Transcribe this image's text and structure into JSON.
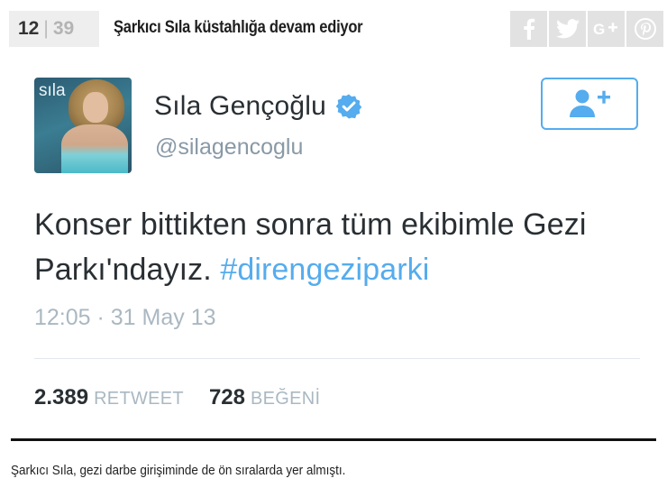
{
  "header": {
    "current_index": "12",
    "total_count": "39",
    "headline": "Şarkıcı Sıla küstahlığa devam ediyor",
    "share_buttons": [
      {
        "icon": "facebook-icon",
        "label": "f"
      },
      {
        "icon": "twitter-icon"
      },
      {
        "icon": "google-plus-icon",
        "label": "G+"
      },
      {
        "icon": "pinterest-icon",
        "label": "P"
      }
    ]
  },
  "tweet": {
    "avatar_brand": "sıla",
    "name": "Sıla Gençoğlu",
    "handle": "@silagencoglu",
    "text_main": "Konser bittikten sonra tüm ekibimle Gezi Parkı'ndayız.",
    "hashtag": "#direngeziparki",
    "timestamp": "12:05 · 31 May 13",
    "retweet_count": "2.389",
    "retweet_label": "RETWEET",
    "like_count": "728",
    "like_label": "BEĞENİ",
    "accent_color": "#55acee"
  },
  "caption": "Şarkıcı Sıla, gezi darbe girişiminde de ön sıralarda yer almıştı."
}
